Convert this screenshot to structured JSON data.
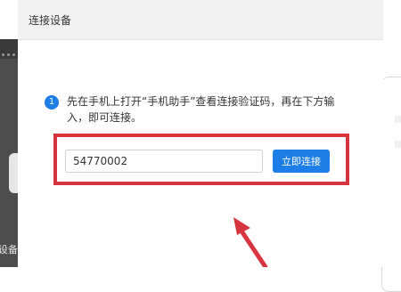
{
  "background": {
    "left_text": "设备"
  },
  "dialog": {
    "title": "连接设备",
    "step_number": "1",
    "instruction": "先在手机上打开“手机助手”查看连接验证码，再在下方输入，即可连接。",
    "code_value": "54770002",
    "connect_label": "立即连接"
  },
  "colors": {
    "accent": "#1e7ee8",
    "highlight": "#d7353e",
    "titlebar": "#f2f2f2"
  }
}
